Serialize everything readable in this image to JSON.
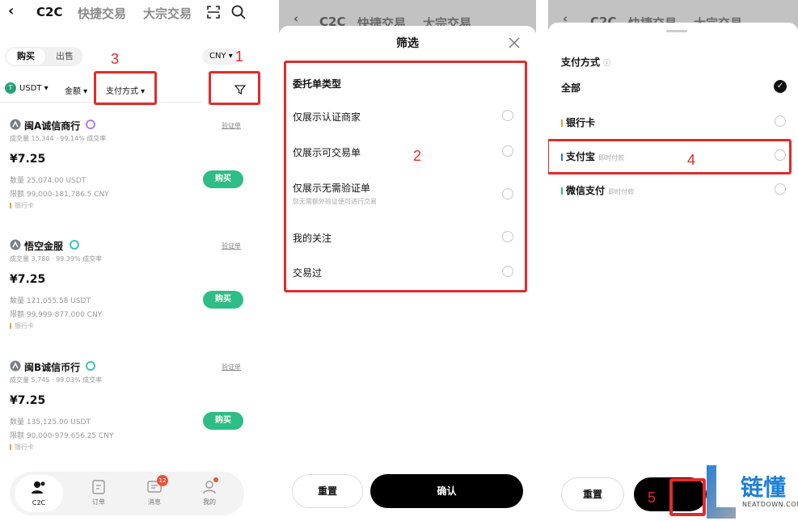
{
  "panel1": {
    "nav": {
      "back": "‹",
      "tab_c2c": "C2C",
      "tab_quick": "快捷交易",
      "tab_block": "大宗交易"
    },
    "side_tabs": {
      "buy": "购买",
      "sell": "出售"
    },
    "currency": "CNY",
    "filters": {
      "coin": "USDT",
      "amount": "金额",
      "payment": "支付方式"
    },
    "listings": [
      {
        "merchant": "闽A诚信商行",
        "verify": "验证单",
        "stats": "成交量 15,344 · 99.14% 成交率",
        "price": "¥7.25",
        "qty": "数量  25,074.00 USDT",
        "limit": "限额  99,000-181,786.5 CNY",
        "payment": "银行卡",
        "buy_label": "购买"
      },
      {
        "merchant": "悟空金服",
        "verify": "验证单",
        "stats": "成交量 3,780 · 99.39% 成交率",
        "price": "¥7.25",
        "qty": "数量  121,055.58 USDT",
        "limit": "限额  99,999-877,000 CNY",
        "payment": "银行卡",
        "buy_label": "购买"
      },
      {
        "merchant": "闽B诚信币行",
        "verify": "验证单",
        "stats": "成交量 5,745 · 99.03% 成交率",
        "price": "¥7.25",
        "qty": "数量  135,125.00 USDT",
        "limit": "限额  90,000-979,656.25 CNY",
        "payment": "银行卡",
        "buy_label": "购买"
      }
    ],
    "bottom_nav": [
      {
        "label": "C2C",
        "icon": "person-icon"
      },
      {
        "label": "订单",
        "icon": "order-icon"
      },
      {
        "label": "消息",
        "icon": "message-icon",
        "badge": "12"
      },
      {
        "label": "我的",
        "icon": "profile-icon"
      }
    ]
  },
  "panel2": {
    "bg_nav": {
      "back": "‹",
      "tab_c2c": "C2C",
      "tab_quick": "快捷交易",
      "tab_block": "大宗交易"
    },
    "title": "筛选",
    "section": "委托单类型",
    "options": [
      {
        "label": "仅展示认证商家",
        "hint": ""
      },
      {
        "label": "仅展示可交易单",
        "hint": ""
      },
      {
        "label": "仅展示无需验证单",
        "hint": "您无需额外验证便可进行交易"
      },
      {
        "label": "我的关注",
        "hint": ""
      },
      {
        "label": "交易过",
        "hint": ""
      }
    ],
    "reset": "重置",
    "confirm": "确认"
  },
  "panel3": {
    "bg_nav": {
      "back": "‹",
      "tab_c2c": "C2C",
      "tab_quick": "快捷交易",
      "tab_block": "大宗交易"
    },
    "section": "支付方式",
    "options": [
      {
        "label": "全部",
        "note": "",
        "color": "",
        "selected": true
      },
      {
        "label": "银行卡",
        "note": "",
        "color": "#e6a23c",
        "selected": false
      },
      {
        "label": "支付宝",
        "note": "即时付款",
        "color": "#1677ff",
        "selected": false
      },
      {
        "label": "微信支付",
        "note": "即时付款",
        "color": "#2ebd85",
        "selected": false
      }
    ],
    "reset": "重置"
  },
  "annotations": [
    "1",
    "2",
    "3",
    "4",
    "5"
  ],
  "watermark": {
    "brand": "链懂",
    "site": "NEATDOWN.COM",
    "letter": "L"
  }
}
